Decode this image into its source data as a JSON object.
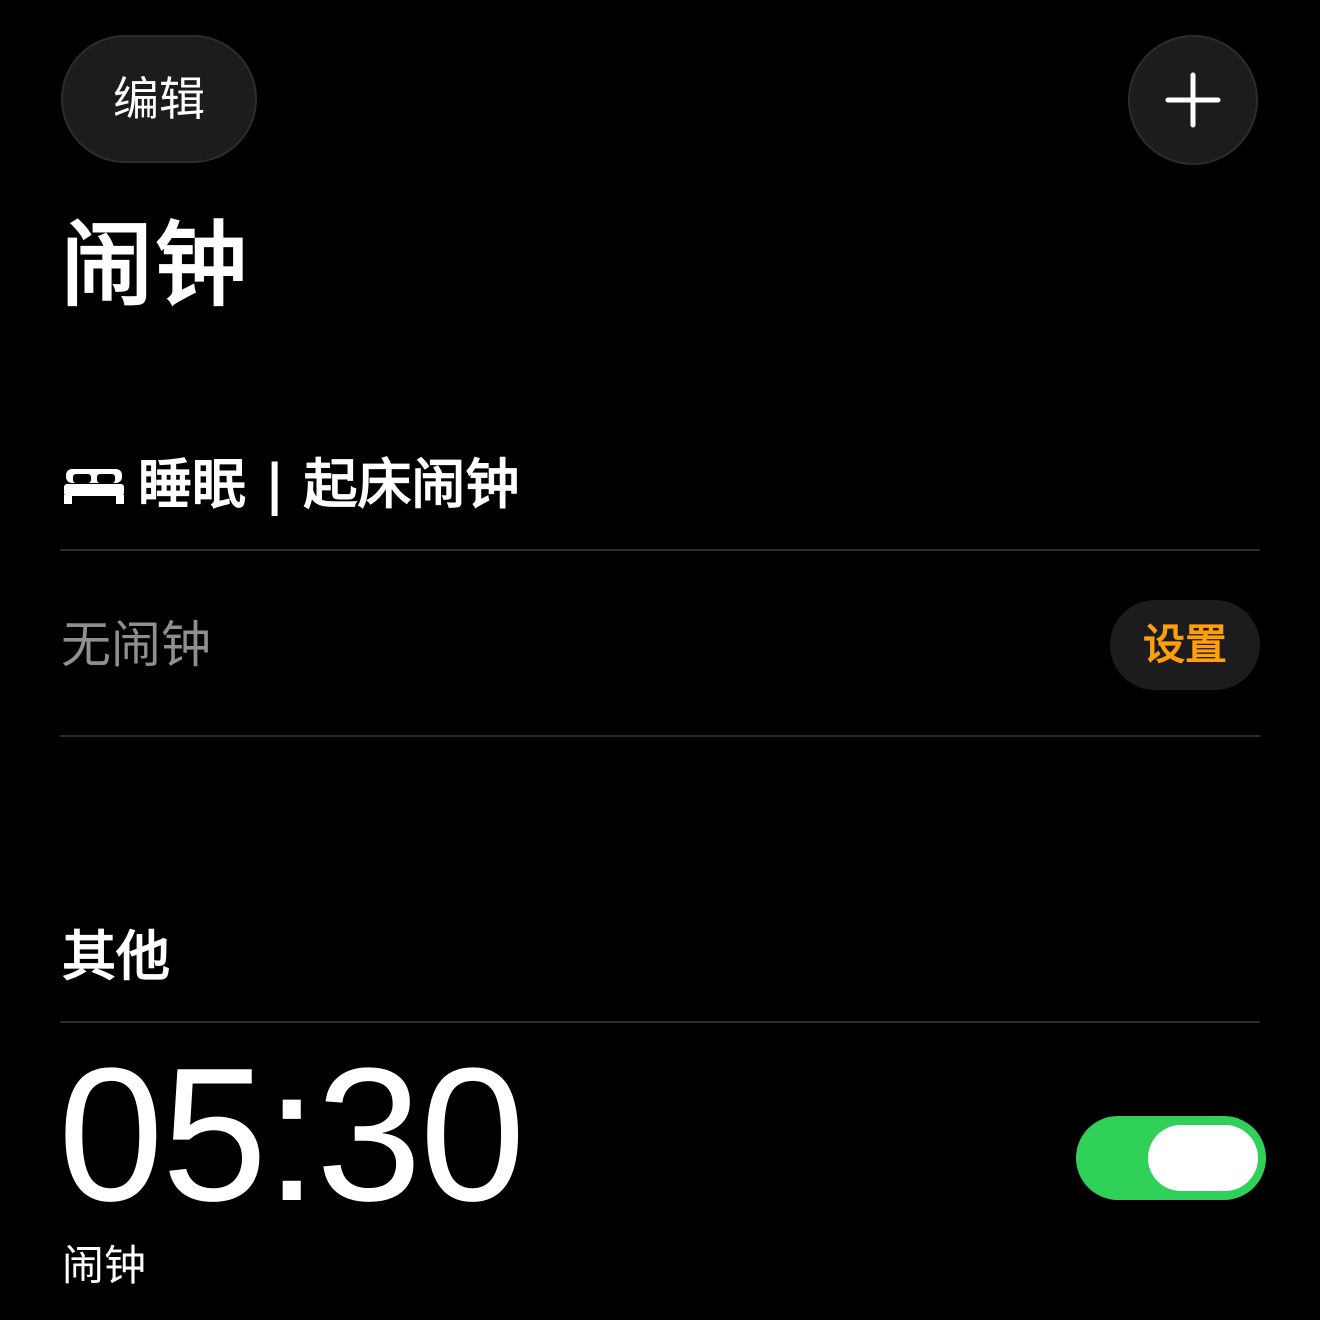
{
  "colors": {
    "background": "#000000",
    "accent": "#ff9f0a",
    "toggle_on": "#30d158",
    "secondary_text": "#8e8e93"
  },
  "toolbar": {
    "edit_label": "编辑",
    "add_icon": "plus-icon"
  },
  "page": {
    "title": "闹钟"
  },
  "sleep_section": {
    "icon": "bed-icon",
    "title": "睡眠 | 起床闹钟",
    "empty_text": "无闹钟",
    "setup_label": "设置"
  },
  "other_section": {
    "title": "其他",
    "alarms": [
      {
        "time": "05:30",
        "label": "闹钟",
        "enabled": true
      }
    ]
  }
}
